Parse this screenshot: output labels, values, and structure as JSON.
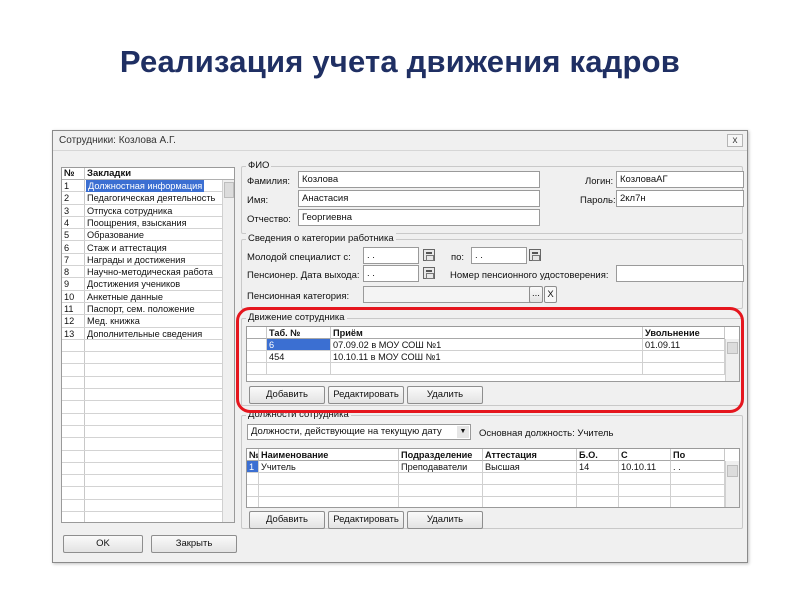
{
  "slide_title": "Реализация учета движения кадров",
  "window": {
    "title": "Сотрудники: Козлова А.Г.",
    "close": "x"
  },
  "left_list": {
    "header_num": "№",
    "header_label": "Закладки",
    "items": [
      {
        "num": "1",
        "label": "Должностная информация",
        "selected": true
      },
      {
        "num": "2",
        "label": "Педагогическая деятельность"
      },
      {
        "num": "3",
        "label": "Отпуска сотрудника"
      },
      {
        "num": "4",
        "label": "Поощрения, взыскания"
      },
      {
        "num": "5",
        "label": "Образование"
      },
      {
        "num": "6",
        "label": "Стаж и аттестация"
      },
      {
        "num": "7",
        "label": "Награды и достижения"
      },
      {
        "num": "8",
        "label": "Научно-методическая работа"
      },
      {
        "num": "9",
        "label": "Достижения учеников"
      },
      {
        "num": "10",
        "label": "Анкетные данные"
      },
      {
        "num": "11",
        "label": "Паспорт, сем. положение"
      },
      {
        "num": "12",
        "label": "Мед. книжка"
      },
      {
        "num": "13",
        "label": "Дополнительные сведения"
      }
    ]
  },
  "fio": {
    "group_title": "ФИО",
    "surname_label": "Фамилия:",
    "surname": "Козлова",
    "name_label": "Имя:",
    "name": "Анастасия",
    "patronymic_label": "Отчество:",
    "patronymic": "Георгиевна",
    "login_label": "Логин:",
    "login": "КозловаАГ",
    "password_label": "Пароль:",
    "password": "2кл7н"
  },
  "category": {
    "group_title": "Сведения о категории работника",
    "young_label": "Молодой специалист с:",
    "young_from": ". .",
    "to_label": "по:",
    "young_to": ". .",
    "pension_label": "Пенсионер. Дата выхода:",
    "pension_date": ". .",
    "pension_cert_label": "Номер пенсионного удостоверения:",
    "pension_cert": "",
    "pension_cat_label": "Пенсионная категория:",
    "pension_cat": "",
    "ellipsis": "...",
    "clear": "X"
  },
  "movement": {
    "group_title": "Движение сотрудника",
    "columns": [
      "Таб. №",
      "Приём",
      "Увольнение"
    ],
    "rows": [
      {
        "tab": "6",
        "hire": "07.09.02 в МОУ СОШ №1",
        "fire": "01.09.11",
        "selected": true
      },
      {
        "tab": "454",
        "hire": "10.10.11 в МОУ СОШ №1",
        "fire": ""
      }
    ],
    "add": "Добавить",
    "edit": "Редактировать",
    "delete": "Удалить"
  },
  "positions": {
    "group_title": "Должности сотрудника",
    "filter_value": "Должности, действующие на текущую дату",
    "main_position": "Основная должность: Учитель",
    "columns": [
      "№",
      "Наименование",
      "Подразделение",
      "Аттестация",
      "Б.О.",
      "С",
      "По"
    ],
    "rows": [
      {
        "num": "1",
        "name": "Учитель",
        "dept": "Преподаватели",
        "attest": "Высшая",
        "bo": "14",
        "from": "10.10.11",
        "to": ". ."
      }
    ],
    "add": "Добавить",
    "edit": "Редактировать",
    "delete": "Удалить"
  },
  "footer": {
    "ok": "OK",
    "close": "Закрыть"
  }
}
